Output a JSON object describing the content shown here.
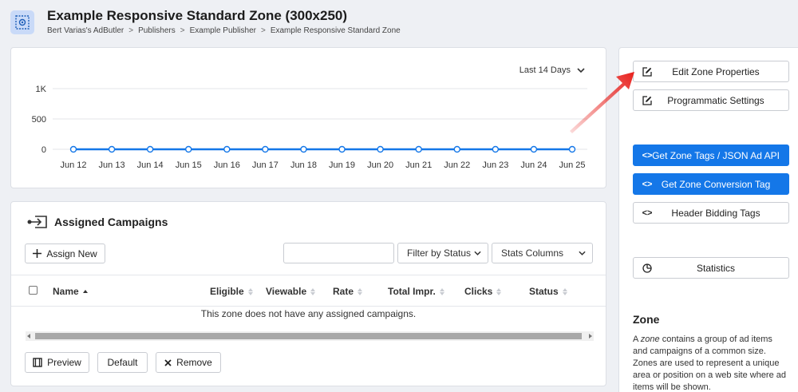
{
  "header": {
    "title": "Example Responsive Standard Zone (300x250)",
    "breadcrumb": [
      "Bert Varias's AdButler",
      "Publishers",
      "Example Publisher",
      "Example Responsive Standard Zone"
    ],
    "breadcrumb_sep": ">"
  },
  "stats_chart": {
    "range_label": "Last 14 Days"
  },
  "chart_data": {
    "type": "line",
    "categories": [
      "Jun 12",
      "Jun 13",
      "Jun 14",
      "Jun 15",
      "Jun 16",
      "Jun 17",
      "Jun 18",
      "Jun 19",
      "Jun 20",
      "Jun 21",
      "Jun 22",
      "Jun 23",
      "Jun 24",
      "Jun 25"
    ],
    "series": [
      {
        "values": [
          0,
          0,
          0,
          0,
          0,
          0,
          0,
          0,
          0,
          0,
          0,
          0,
          0,
          0
        ]
      }
    ],
    "ytick_labels": [
      "1K",
      "500",
      "0"
    ],
    "yticks": [
      1000,
      500,
      0
    ],
    "ylim": [
      0,
      1000
    ],
    "grid": true,
    "line_color": "#1477e8"
  },
  "campaigns": {
    "title": "Assigned Campaigns",
    "assign_new_label": "Assign New",
    "search_value": "",
    "filter_label": "Filter by Status",
    "stats_columns_label": "Stats Columns",
    "columns": [
      "Name",
      "Eligible",
      "Viewable",
      "Rate",
      "Total Impr.",
      "Clicks",
      "Status"
    ],
    "empty_message": "This zone does not have any assigned campaigns.",
    "footer_buttons": {
      "preview": "Preview",
      "default": "Default",
      "remove": "Remove"
    }
  },
  "sidebar": {
    "edit_zone_label": "Edit Zone Properties",
    "programmatic_label": "Programmatic Settings",
    "get_tags_label": "Get Zone Tags / JSON Ad API",
    "conversion_tag_label": "Get Zone Conversion Tag",
    "header_bidding_label": "Header Bidding Tags",
    "statistics_label": "Statistics",
    "code_icon_text": "<>",
    "info_title": "Zone",
    "info_lead": "A ",
    "info_em": "zone",
    "info_rest": " contains a group of ad items and campaigns of a common size. Zones are used to represent a unique area or position on a web site where ad items will be shown."
  },
  "colors": {
    "accent": "#1477e8",
    "annotation_arrow": "#e8201c"
  }
}
